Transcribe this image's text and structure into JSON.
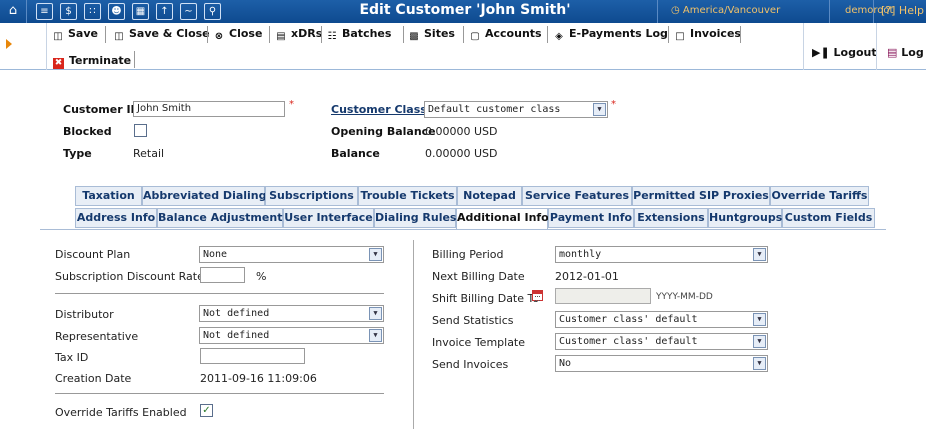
{
  "window": {
    "title": "Edit Customer 'John Smith'",
    "timezone": "America/Vancouver",
    "user": "demoroot",
    "help": "Help"
  },
  "toolbar": {
    "save": "Save",
    "save_close": "Save & Close",
    "close": "Close",
    "xdrs": "xDRs",
    "batches": "Batches",
    "sites": "Sites",
    "accounts": "Accounts",
    "epayments": "E-Payments Log",
    "invoices": "Invoices",
    "terminate": "Terminate",
    "logout": "Logout",
    "log": "Log"
  },
  "customer": {
    "id_label": "Customer ID",
    "id_value": "John Smith",
    "blocked_label": "Blocked",
    "blocked": false,
    "type_label": "Type",
    "type_value": "Retail",
    "class_label": "Customer Class",
    "class_value": "Default customer class",
    "opening_balance_label": "Opening Balance",
    "opening_balance_value": "0.00000 USD",
    "balance_label": "Balance",
    "balance_value": "0.00000 USD"
  },
  "tabs": {
    "row1": [
      "Taxation",
      "Abbreviated Dialing",
      "Subscriptions",
      "Trouble Tickets",
      "Notepad",
      "Service Features",
      "Permitted SIP Proxies",
      "Override Tariffs"
    ],
    "row2": [
      "Address Info",
      "Balance Adjustments",
      "User Interface",
      "Dialing Rules",
      "Additional Info",
      "Payment Info",
      "Extensions",
      "Huntgroups",
      "Custom Fields"
    ],
    "active": "Additional Info"
  },
  "left": {
    "discount_plan_label": "Discount Plan",
    "discount_plan_value": "None",
    "sub_discount_label": "Subscription Discount Rate",
    "sub_discount_value": "",
    "percent": "%",
    "distributor_label": "Distributor",
    "distributor_value": "Not defined",
    "representative_label": "Representative",
    "representative_value": "Not defined",
    "tax_id_label": "Tax ID",
    "tax_id_value": "",
    "creation_date_label": "Creation Date",
    "creation_date_value": "2011-09-16 11:09:06",
    "override_label": "Override Tariffs Enabled",
    "override_enabled": true
  },
  "right": {
    "billing_period_label": "Billing Period",
    "billing_period_value": "monthly",
    "next_billing_label": "Next Billing Date",
    "next_billing_value": "2012-01-01",
    "shift_billing_label": "Shift Billing Date To",
    "shift_billing_value": "",
    "shift_billing_hint": "YYYY-MM-DD",
    "send_stats_label": "Send Statistics",
    "send_stats_value": "Customer class' default",
    "invoice_template_label": "Invoice Template",
    "invoice_template_value": "Customer class' default",
    "send_invoices_label": "Send Invoices",
    "send_invoices_value": "No"
  },
  "colors": {
    "topbar": "#1d5fa8",
    "accent": "#f1c26a",
    "link": "#15396d",
    "required": "#d9261c"
  }
}
